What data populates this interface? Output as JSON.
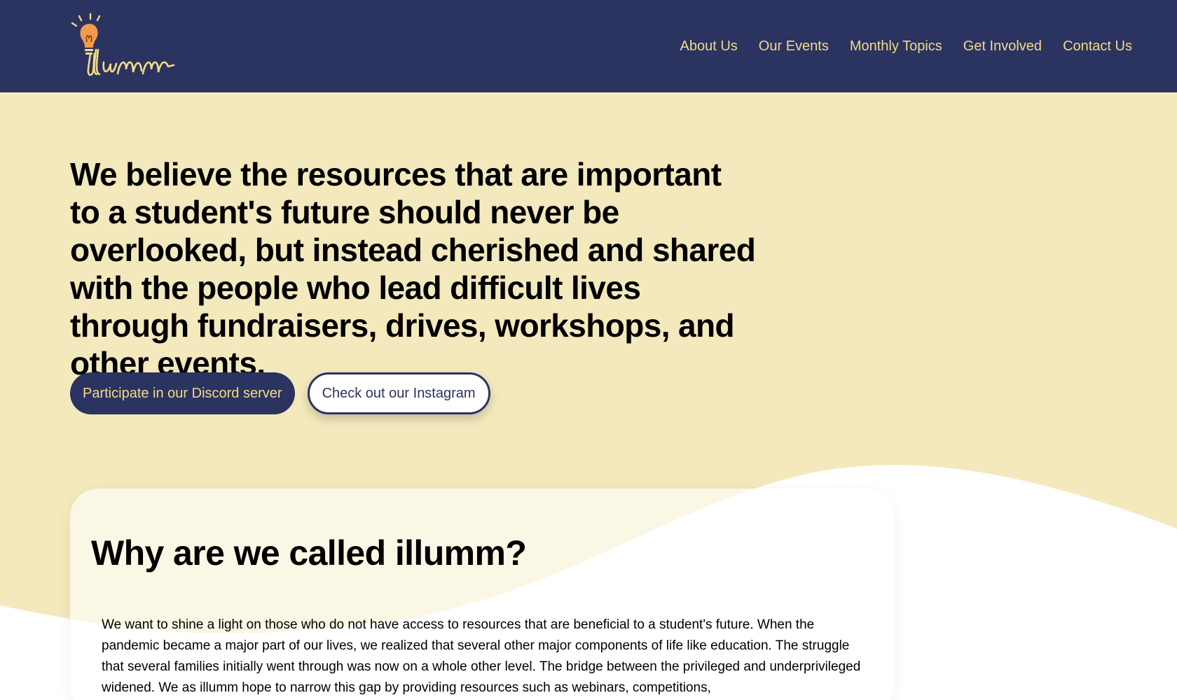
{
  "header": {
    "logo_text": "illumm",
    "nav": [
      {
        "label": "About Us"
      },
      {
        "label": "Our Events"
      },
      {
        "label": "Monthly Topics"
      },
      {
        "label": "Get Involved"
      },
      {
        "label": "Contact Us"
      }
    ]
  },
  "hero": {
    "heading": "We believe the resources that are important to a student's future should never be overlooked, but instead cherished and shared with the people who lead difficult lives through fundraisers, drives, workshops, and other events.",
    "primary_button": "Participate in our Discord server",
    "secondary_button": "Check out our Instagram"
  },
  "about": {
    "heading": "Why are we called illumm?",
    "body": "We want to shine a light on those who do not have access to resources that are beneficial to a student's future. When the pandemic became a major part of our lives, we realized that several other major components of life like education. The struggle that several families initially went through was now on a whole other level. The bridge between the privileged and underprivileged widened. We as illumm hope to narrow this gap by providing resources such as webinars, competitions,"
  },
  "colors": {
    "header_bg": "#2b3360",
    "nav_text": "#f2db85",
    "page_bg": "#f3e9bc",
    "bulb_orange": "#f29b4b"
  }
}
